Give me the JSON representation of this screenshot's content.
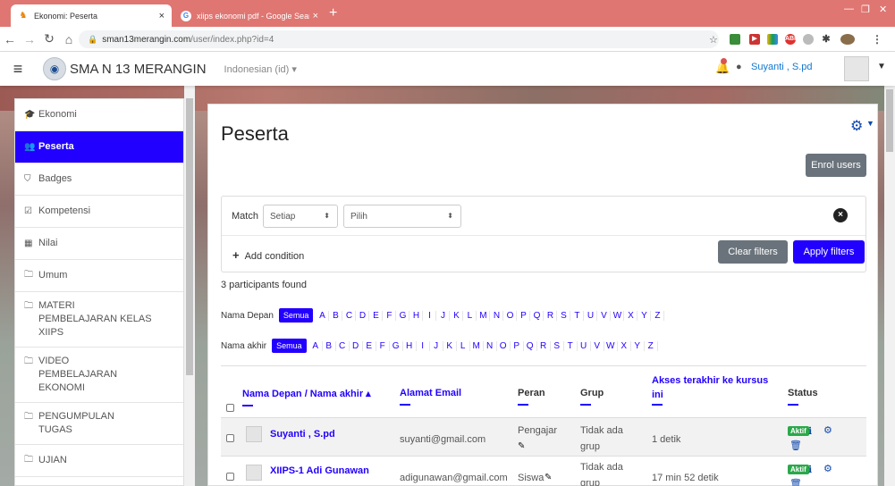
{
  "browser": {
    "tabs": [
      {
        "title": "Ekonomi: Peserta",
        "close": "×"
      },
      {
        "title": "xiips ekonomi pdf - Google Searc",
        "close": "×"
      }
    ],
    "newtab": "+",
    "url_host": "sman13merangin.com",
    "url_path": "/user/index.php?id=4"
  },
  "navbar": {
    "site_name": "SMA N 13 MERANGIN",
    "language": "Indonesian (id) ▾",
    "user_name": "Suyanti , S.pd"
  },
  "sidebar": {
    "items": [
      {
        "label": "Ekonomi",
        "icon": "graduation-cap-icon"
      },
      {
        "label": "Peserta",
        "icon": "users-icon",
        "active": true
      },
      {
        "label": "Badges",
        "icon": "shield-icon"
      },
      {
        "label": "Kompetensi",
        "icon": "check-square-icon"
      },
      {
        "label": "Nilai",
        "icon": "table-icon"
      },
      {
        "label": "Umum",
        "icon": "folder-icon"
      },
      {
        "label": "MATERI PEMBELAJARAN KELAS XIIPS",
        "icon": "folder-icon"
      },
      {
        "label": "VIDEO PEMBELAJARAN EKONOMI",
        "icon": "folder-icon"
      },
      {
        "label": "PENGUMPULAN TUGAS",
        "icon": "folder-icon"
      },
      {
        "label": "UJIAN",
        "icon": "folder-icon"
      }
    ]
  },
  "main": {
    "title": "Peserta",
    "enrol_button": "Enrol users",
    "filter": {
      "match_label": "Match",
      "match_value": "Setiap",
      "condition_value": "Pilih",
      "add_condition": "Add condition",
      "clear_button": "Clear filters",
      "apply_button": "Apply filters"
    },
    "participants_found": "3 participants found",
    "firstname_label": "Nama Depan",
    "lastname_label": "Nama akhir",
    "all_label": "Semua",
    "letters": [
      "A",
      "B",
      "C",
      "D",
      "E",
      "F",
      "G",
      "H",
      "I",
      "J",
      "K",
      "L",
      "M",
      "N",
      "O",
      "P",
      "Q",
      "R",
      "S",
      "T",
      "U",
      "V",
      "W",
      "X",
      "Y",
      "Z"
    ],
    "columns": {
      "name": "Nama Depan / Nama akhir ▴",
      "email": "Alamat Email",
      "role": "Peran",
      "group": "Grup",
      "last_access_1": "Akses terakhir ke kursus",
      "last_access_2": "ini",
      "status": "Status"
    },
    "rows": [
      {
        "name": "Suyanti , S.pd",
        "email": "suyanti@gmail.com",
        "role": "Pengajar",
        "group_1": "Tidak ada",
        "group_2": "grup",
        "last_access": "1 detik",
        "status": "Aktif"
      },
      {
        "name": "XIIPS-1 Adi Gunawan",
        "email": "adigunawan@gmail.com",
        "role": "Siswa",
        "group_1": "Tidak ada",
        "group_2": "grup",
        "last_access": "17 min 52 detik",
        "status": "Aktif"
      }
    ]
  },
  "colors": {
    "accent": "#2200ff",
    "tabbar": "#df7672",
    "status_active": "#2ca84b"
  }
}
